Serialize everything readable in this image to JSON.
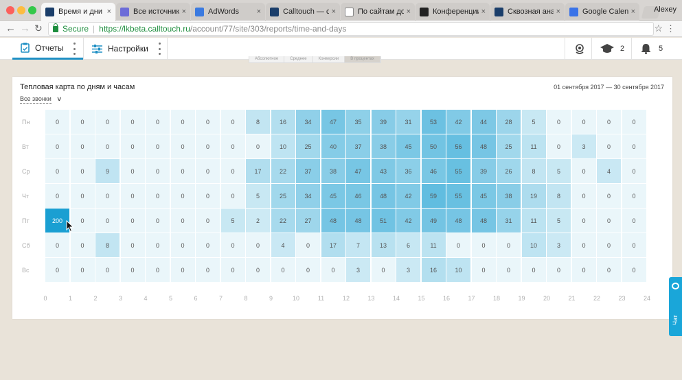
{
  "browser": {
    "tabs": [
      {
        "title": "Время и дни н",
        "active": true,
        "icon": "calltouch-favicon",
        "icon_color": "#1b3e6a"
      },
      {
        "title": "Все источники",
        "active": false,
        "icon": "globe-favicon",
        "icon_color": "#6c6cd8"
      },
      {
        "title": "AdWords",
        "active": false,
        "icon": "adwords-favicon",
        "icon_color": "#3b7ae0"
      },
      {
        "title": "Calltouch — с",
        "active": false,
        "icon": "calltouch-favicon",
        "icon_color": "#1b3e6a"
      },
      {
        "title": "По сайтам до",
        "active": false,
        "icon": "page-favicon",
        "icon_color": "#ffffff"
      },
      {
        "title": "Конференции",
        "active": false,
        "icon": "c-favicon",
        "icon_color": "#222222"
      },
      {
        "title": "Сквозная ана",
        "active": false,
        "icon": "calltouch-favicon",
        "icon_color": "#1b3e6a"
      },
      {
        "title": "Google Calend",
        "active": false,
        "icon": "calendar-favicon",
        "icon_color": "#3a73e8"
      }
    ],
    "user": "Alexey",
    "secure_label": "Secure",
    "url_host": "https://lkbeta.calltouch.ru",
    "url_path": "/account/77/site/303/reports/time-and-days"
  },
  "header": {
    "reports_label": "Отчеты",
    "settings_label": "Настройки",
    "education_count": "2",
    "notifications_count": "5",
    "toggle_items": [
      "Абсолютное",
      "Среднее",
      "Конверсии",
      "В процентах"
    ]
  },
  "card": {
    "title": "Тепловая карта по дням и часам",
    "filter": "Все звонки",
    "date_range": "01 сентября 2017 — 30 сентября 2017"
  },
  "chart_data": {
    "type": "heatmap",
    "title": "Тепловая карта по дням и часам",
    "y_categories": [
      "Пн",
      "Вт",
      "Ср",
      "Чт",
      "Пт",
      "Сб",
      "Вс"
    ],
    "x_ticks": [
      "0",
      "1",
      "2",
      "3",
      "4",
      "5",
      "6",
      "7",
      "8",
      "9",
      "10",
      "11",
      "12",
      "13",
      "14",
      "15",
      "16",
      "17",
      "18",
      "19",
      "20",
      "21",
      "22",
      "23",
      "24"
    ],
    "values": [
      [
        0,
        0,
        0,
        0,
        0,
        0,
        0,
        0,
        8,
        16,
        34,
        47,
        35,
        39,
        31,
        53,
        42,
        44,
        28,
        5,
        0,
        0,
        0,
        0
      ],
      [
        0,
        0,
        0,
        0,
        0,
        0,
        0,
        0,
        0,
        10,
        25,
        40,
        37,
        38,
        45,
        50,
        56,
        48,
        25,
        11,
        0,
        3,
        0,
        0
      ],
      [
        0,
        0,
        9,
        0,
        0,
        0,
        0,
        0,
        17,
        22,
        37,
        38,
        47,
        43,
        36,
        46,
        55,
        39,
        26,
        8,
        5,
        0,
        4,
        0
      ],
      [
        0,
        0,
        0,
        0,
        0,
        0,
        0,
        0,
        5,
        25,
        34,
        45,
        46,
        48,
        42,
        59,
        55,
        45,
        38,
        19,
        8,
        0,
        0,
        0
      ],
      [
        200,
        0,
        0,
        0,
        0,
        0,
        0,
        5,
        2,
        22,
        27,
        48,
        48,
        51,
        42,
        49,
        48,
        48,
        31,
        11,
        5,
        0,
        0,
        0
      ],
      [
        0,
        0,
        8,
        0,
        0,
        0,
        0,
        0,
        0,
        4,
        0,
        17,
        7,
        13,
        6,
        11,
        0,
        0,
        0,
        10,
        3,
        0,
        0,
        0
      ],
      [
        0,
        0,
        0,
        0,
        0,
        0,
        0,
        0,
        0,
        0,
        0,
        0,
        3,
        0,
        3,
        16,
        10,
        0,
        0,
        0,
        0,
        0,
        0,
        0
      ]
    ],
    "color_low": "#eaf6fa",
    "color_high": "#1a9fd2"
  },
  "chat": {
    "label": "Чат"
  }
}
